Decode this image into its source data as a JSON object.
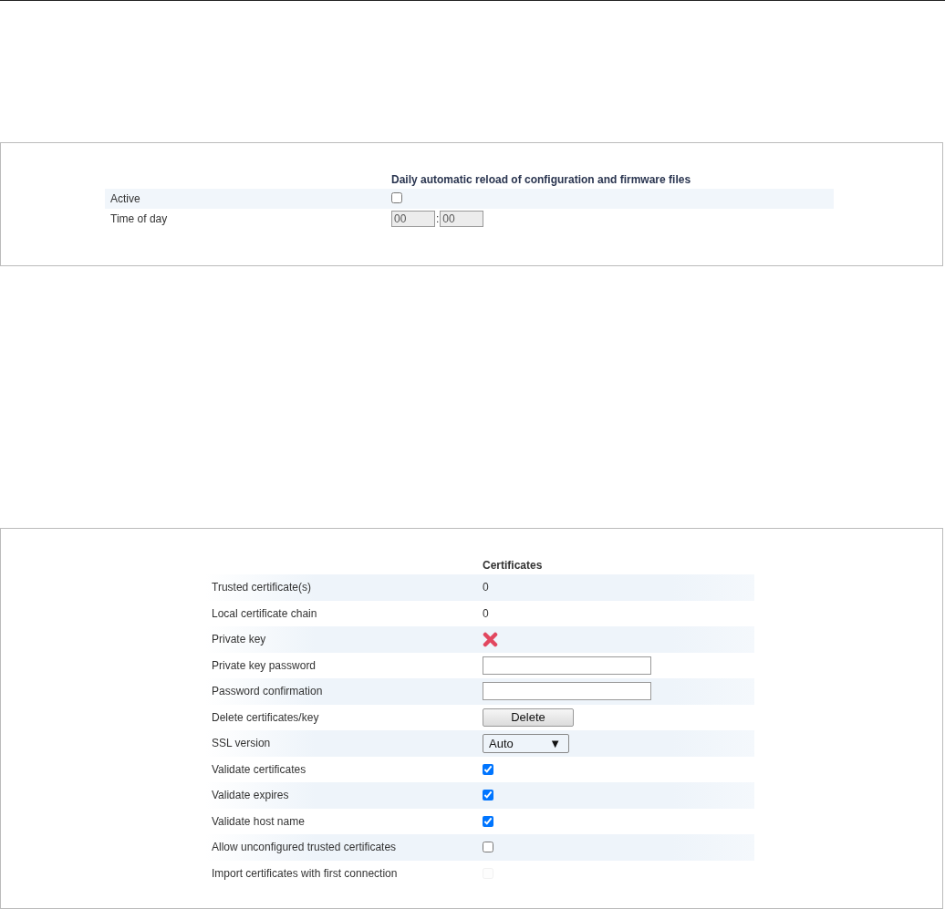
{
  "reload_panel": {
    "heading": "Daily automatic reload of configuration and firmware files",
    "active": {
      "label": "Active",
      "checked": false
    },
    "time": {
      "label": "Time of day",
      "hours": "00",
      "separator": ":",
      "minutes": "00"
    }
  },
  "certificates_panel": {
    "heading": "Certificates",
    "rows": [
      {
        "kind": "text",
        "label": "Trusted certificate(s)",
        "value": "0"
      },
      {
        "kind": "text",
        "label": "Local certificate chain",
        "value": "0"
      },
      {
        "kind": "status",
        "label": "Private key"
      },
      {
        "kind": "input",
        "label": "Private key password"
      },
      {
        "kind": "input",
        "label": "Password confirmation"
      },
      {
        "kind": "button",
        "label": "Delete certificates/key",
        "value": "Delete"
      },
      {
        "kind": "select",
        "label": "SSL version",
        "value": "Auto",
        "arrow": "▼"
      },
      {
        "kind": "checkbox",
        "label": "Validate certificates",
        "checked": true,
        "disabled": false
      },
      {
        "kind": "checkbox",
        "label": "Validate expires",
        "checked": true,
        "disabled": false
      },
      {
        "kind": "checkbox",
        "label": "Validate host name",
        "checked": true,
        "disabled": false
      },
      {
        "kind": "checkbox",
        "label": "Allow unconfigured trusted certificates",
        "checked": false,
        "disabled": false
      },
      {
        "kind": "checkbox",
        "label": "Import certificates with first connection",
        "checked": false,
        "disabled": true
      }
    ]
  }
}
